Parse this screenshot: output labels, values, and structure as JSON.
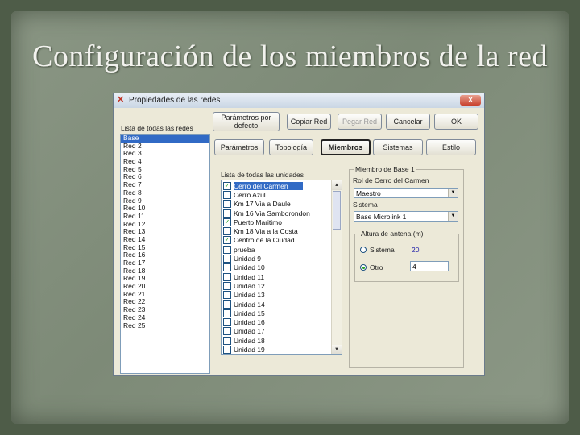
{
  "slide": {
    "title": "Configuración de los miembros de la red"
  },
  "window": {
    "title": "Propiedades de las redes",
    "close": "X"
  },
  "top_buttons": {
    "defaults": "Parámetros por defecto",
    "copy": "Copiar Red",
    "paste": "Pegar Red",
    "cancel": "Cancelar",
    "ok": "OK"
  },
  "networks": {
    "label": "Lista de todas las redes",
    "items": [
      "Base",
      "Red 2",
      "Red 3",
      "Red 4",
      "Red 5",
      "Red 6",
      "Red 7",
      "Red 8",
      "Red 9",
      "Red 10",
      "Red 11",
      "Red 12",
      "Red 13",
      "Red 14",
      "Red 15",
      "Red 16",
      "Red 17",
      "Red 18",
      "Red 19",
      "Red 20",
      "Red 21",
      "Red 22",
      "Red 23",
      "Red 24",
      "Red 25"
    ],
    "selected_index": 0
  },
  "tabs": {
    "items": [
      "Parámetros",
      "Topología",
      "Miembros",
      "Sistemas",
      "Estilo"
    ],
    "active_index": 2
  },
  "units": {
    "label": "Lista de todas las unidades",
    "items": [
      {
        "label": "Cerro del Carmen",
        "checked": true
      },
      {
        "label": "Cerro Azul",
        "checked": false
      },
      {
        "label": "Km 17 Via a Daule",
        "checked": false
      },
      {
        "label": "Km 16 Via Samborondon",
        "checked": false
      },
      {
        "label": "Puerto Maritimo",
        "checked": true
      },
      {
        "label": "Km 18 Via a la Costa",
        "checked": false
      },
      {
        "label": "Centro de la Ciudad",
        "checked": true
      },
      {
        "label": "prueba",
        "checked": false
      },
      {
        "label": "Unidad 9",
        "checked": false
      },
      {
        "label": "Unidad 10",
        "checked": false
      },
      {
        "label": "Unidad 11",
        "checked": false
      },
      {
        "label": "Unidad 12",
        "checked": false
      },
      {
        "label": "Unidad 13",
        "checked": false
      },
      {
        "label": "Unidad 14",
        "checked": false
      },
      {
        "label": "Unidad 15",
        "checked": false
      },
      {
        "label": "Unidad 16",
        "checked": false
      },
      {
        "label": "Unidad 17",
        "checked": false
      },
      {
        "label": "Unidad 18",
        "checked": false
      },
      {
        "label": "Unidad 19",
        "checked": false
      }
    ],
    "selected_index": 0
  },
  "member": {
    "group_title": "Miembro de Base 1",
    "role_label": "Rol de Cerro del Carmen",
    "role_value": "Maestro",
    "system_label": "Sistema",
    "system_value": "Base Microlink 1",
    "antenna_group": "Altura de antena (m)",
    "radio_system": "Sistema",
    "radio_system_value": "20",
    "radio_other": "Otro",
    "other_value": "4",
    "selected_radio": "other",
    "value_color": "#2222aa"
  }
}
